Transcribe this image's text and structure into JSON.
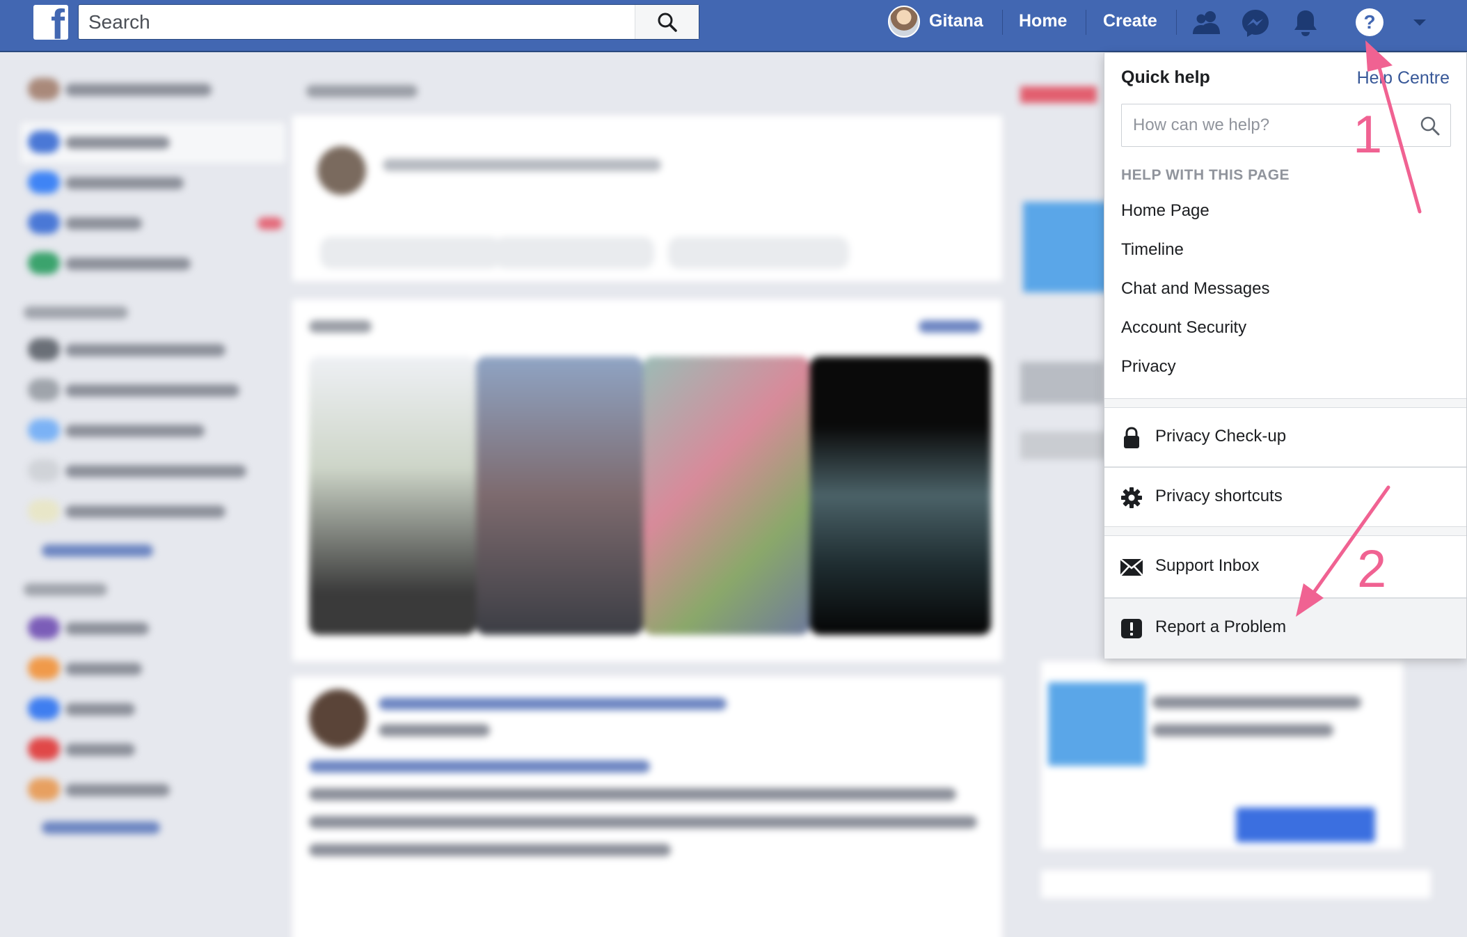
{
  "topbar": {
    "logo": "f",
    "search_placeholder": "Search",
    "user_name": "Gitana",
    "home": "Home",
    "create": "Create",
    "icons": [
      "friends-icon",
      "messenger-icon",
      "notifications-icon",
      "help-icon",
      "account-menu-icon"
    ]
  },
  "help_menu": {
    "title": "Quick help",
    "help_centre": "Help Centre",
    "search_placeholder": "How can we help?",
    "section_header": "HELP WITH THIS PAGE",
    "links": [
      "Home Page",
      "Timeline",
      "Chat and Messages",
      "Account Security",
      "Privacy"
    ],
    "privacy_checkup": "Privacy Check-up",
    "privacy_shortcuts": "Privacy shortcuts",
    "support_inbox": "Support Inbox",
    "report_problem": "Report a Problem"
  },
  "annotations": {
    "step1": "1",
    "step2": "2",
    "color": "#f06292"
  },
  "colors": {
    "brand_blue": "#4267b2",
    "link_blue": "#385898"
  }
}
